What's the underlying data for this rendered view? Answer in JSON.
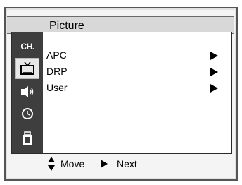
{
  "screen": {
    "title": "Picture"
  },
  "sidebar": {
    "items": [
      {
        "label": "CH.",
        "icon": "channel-icon",
        "selected": false
      },
      {
        "label": "",
        "icon": "tv-icon",
        "selected": true
      },
      {
        "label": "",
        "icon": "speaker-icon",
        "selected": false
      },
      {
        "label": "",
        "icon": "clock-icon",
        "selected": false
      },
      {
        "label": "",
        "icon": "setup-icon",
        "selected": false
      }
    ]
  },
  "menu": {
    "items": [
      {
        "label": "APC",
        "icon": "right-arrow-icon"
      },
      {
        "label": "DRP",
        "icon": "right-arrow-icon"
      },
      {
        "label": "User",
        "icon": "right-arrow-icon"
      }
    ]
  },
  "footer": {
    "move_label": "Move",
    "move_icon": "up-down-arrow-icon",
    "next_label": "Next",
    "next_icon": "right-arrow-icon"
  },
  "colors": {
    "sidebar_bg": "#3e3e3e",
    "selected_bg": "#e8e8e8",
    "title_bar_bg": "#d8d8d8"
  }
}
